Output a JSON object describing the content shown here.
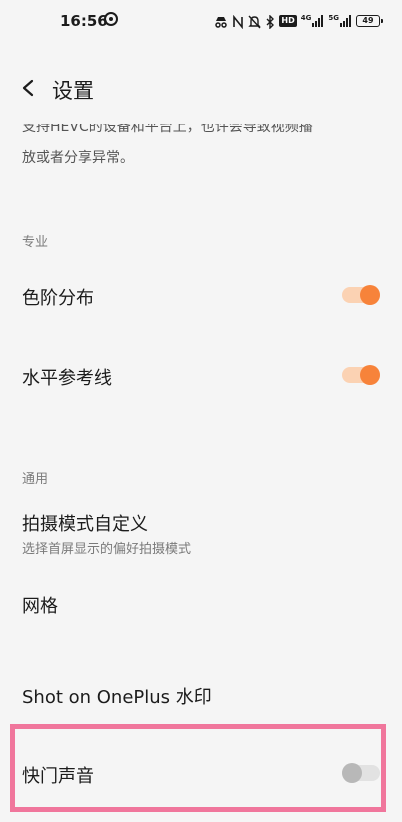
{
  "status_bar": {
    "time": "16:56",
    "hd_badge": "HD",
    "net_1": "4G",
    "net_2": "5G",
    "battery": "49"
  },
  "header": {
    "title": "设置"
  },
  "description": {
    "line1": "支持HEVC的设备和平台上，也许会导致视频播",
    "line2": "放或者分享异常。"
  },
  "sections": {
    "pro": {
      "header": "专业",
      "items": [
        {
          "title": "色阶分布",
          "toggle": "on"
        },
        {
          "title": "水平参考线",
          "toggle": "on"
        }
      ]
    },
    "general": {
      "header": "通用",
      "items": [
        {
          "title": "拍摄模式自定义",
          "subtitle": "选择首屏显示的偏好拍摄模式"
        },
        {
          "title": "网格"
        },
        {
          "title": "Shot on OnePlus 水印"
        },
        {
          "title": "快门声音",
          "toggle": "off"
        }
      ]
    }
  },
  "colors": {
    "accent": "#f7833a",
    "highlight": "#f0769c"
  }
}
